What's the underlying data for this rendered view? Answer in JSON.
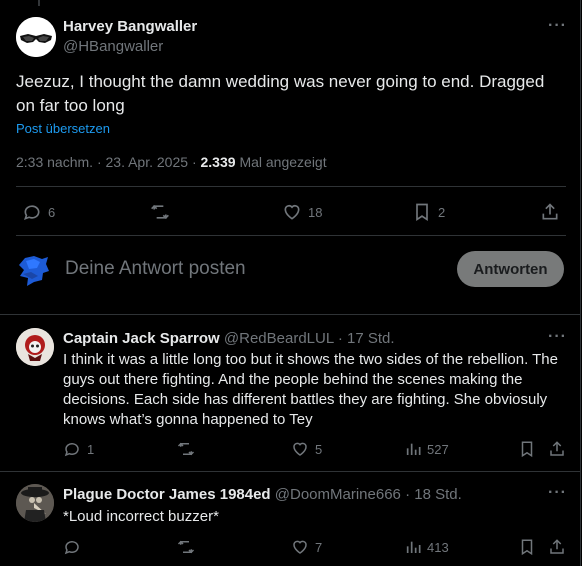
{
  "main_post": {
    "name": "Harvey Bangwaller",
    "handle": "@HBangwaller",
    "text": "Jeezuz, I thought the damn wedding was never going to end. Dragged on far too long",
    "translate": "Post übersetzen",
    "time": "2:33 nachm.",
    "date": "23. Apr. 2025",
    "views_count": "2.339",
    "views_label": "Mal angezeigt",
    "replies": "6",
    "reposts": "",
    "likes": "18",
    "bookmarks": "2"
  },
  "reply_box": {
    "placeholder": "Deine Antwort posten",
    "button": "Antworten"
  },
  "replies": [
    {
      "name": "Captain Jack Sparrow",
      "handle": "@RedBeardLUL",
      "time": "17 Std.",
      "text": "I think it was a little long too but it shows the two sides of the rebellion. The guys out there fighting. And the people behind the scenes making the decisions. Each side has different battles they are fighting. She obviosuly knows what’s gonna happened to Tey",
      "replies": "1",
      "likes": "5",
      "views": "527"
    },
    {
      "name": "Plague Doctor James 1984ed",
      "handle": "@DoomMarine666",
      "time": "18 Std.",
      "text": "*Loud incorrect buzzer*",
      "replies": "",
      "likes": "7",
      "views": "413"
    }
  ],
  "colors": {
    "background": "#000000",
    "text": "#e7e9ea",
    "muted": "#71767b",
    "link": "#1d9bf0",
    "divider": "#2f3336",
    "button_bg": "#787a7a"
  },
  "icons": [
    "more-icon",
    "reply-icon",
    "repost-icon",
    "like-icon",
    "bookmark-icon",
    "share-icon",
    "views-icon"
  ]
}
